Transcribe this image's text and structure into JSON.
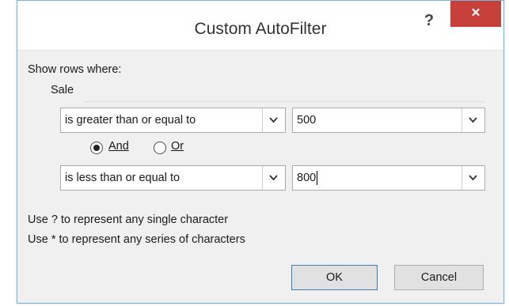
{
  "dialog": {
    "title": "Custom AutoFilter",
    "help_label": "?",
    "close_label": "×"
  },
  "filter": {
    "heading": "Show rows where:",
    "field_name": "Sale",
    "condition1": {
      "operator": "is greater than or equal to",
      "value": "500"
    },
    "logic": {
      "and_label": "And",
      "or_label": "Or",
      "selected": "And"
    },
    "condition2": {
      "operator": "is less than or equal to",
      "value": "800"
    }
  },
  "hints": {
    "single_char": "Use ? to represent any single character",
    "series_chars": "Use * to represent any series of characters"
  },
  "buttons": {
    "ok_label": "OK",
    "cancel_label": "Cancel"
  },
  "icons": {
    "dropdown": "chevron-down-icon",
    "close": "close-icon",
    "help": "help-icon"
  },
  "colors": {
    "close_bg": "#c7403a",
    "dialog_bg": "#f0f0f0",
    "border": "#79b3dc"
  }
}
